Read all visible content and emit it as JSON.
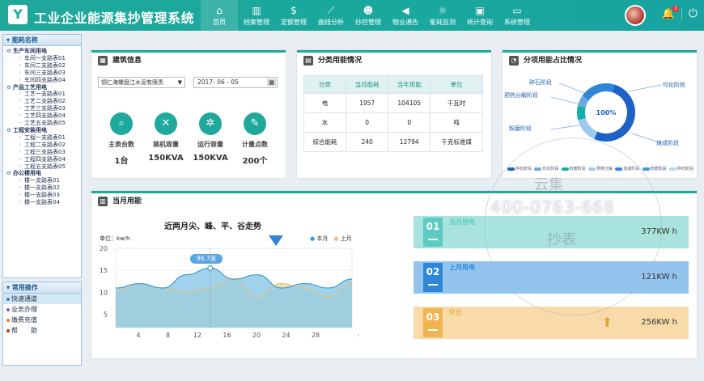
{
  "app": {
    "logo_letter": "Y",
    "title": "工业企业能源集抄管理系统"
  },
  "nav": [
    {
      "label": "首页",
      "icon": "home-icon",
      "glyph": "⌂"
    },
    {
      "label": "档案管理",
      "icon": "books-icon",
      "glyph": "▥"
    },
    {
      "label": "定额管理",
      "icon": "dollar-icon",
      "glyph": "$"
    },
    {
      "label": "曲线分析",
      "icon": "line-chart-icon",
      "glyph": "⟋"
    },
    {
      "label": "抄控管理",
      "icon": "users-icon",
      "glyph": "☻"
    },
    {
      "label": "物业通告",
      "icon": "megaphone-icon",
      "glyph": "◀"
    },
    {
      "label": "能耗监测",
      "icon": "alarm-icon",
      "glyph": "☼"
    },
    {
      "label": "统计查询",
      "icon": "briefcase-icon",
      "glyph": "▣"
    },
    {
      "label": "系统管理",
      "icon": "monitor-icon",
      "glyph": "▭"
    }
  ],
  "header": {
    "badge_count": "1"
  },
  "sidebar": {
    "tree_title": "能耗名称",
    "groups": [
      {
        "label": "生产车间用电",
        "items": [
          "车间一支路表01",
          "车间二支路表02",
          "车间三支路表03",
          "车间四支路表04"
        ]
      },
      {
        "label": "产品工艺用电",
        "items": [
          "工艺一支路表01",
          "工艺二支路表02",
          "工艺三支路表03",
          "工艺四支路表04",
          "工艺五支路表05"
        ]
      },
      {
        "label": "工程安装用电",
        "items": [
          "工程一支路表01",
          "工程二支路表02",
          "工程三支路表03",
          "工程四支路表04",
          "工程五支路表05"
        ]
      },
      {
        "label": "办公楼用电",
        "items": [
          "楼一支路表01",
          "楼一支路表02",
          "楼一支路表03",
          "楼一支路表04"
        ]
      }
    ],
    "ops_title": "常用操作",
    "ops": [
      {
        "label": "快速通道",
        "color": "#3a7bd5"
      },
      {
        "label": "业务办理",
        "color": "#8a56c7"
      },
      {
        "label": "缴费充值",
        "color": "#e67e22"
      },
      {
        "label": "帮　　助",
        "color": "#c0392b"
      }
    ]
  },
  "building": {
    "title": "建筑信息",
    "select_value": "铜仁海螺盘江水泥有限责",
    "date": "2017- 06 - 05",
    "stats": [
      {
        "label": "主表台数",
        "value": "1台",
        "icon": "search-icon",
        "glyph": "⌕"
      },
      {
        "label": "装机容量",
        "value": "150KVA",
        "icon": "tools-icon",
        "glyph": "✕"
      },
      {
        "label": "运行容量",
        "value": "150KVA",
        "icon": "gears-icon",
        "glyph": "✲"
      },
      {
        "label": "计量点数",
        "value": "200个",
        "icon": "edit-icon",
        "glyph": "✎"
      }
    ]
  },
  "category": {
    "title": "分类用能情况",
    "headers": [
      "分类",
      "当月能耗",
      "当年用能",
      "单位"
    ],
    "rows": [
      [
        "电",
        "1957",
        "104105",
        "千瓦时"
      ],
      [
        "水",
        "0",
        "0",
        "吨"
      ],
      [
        "综合能耗",
        "240",
        "12794",
        "千克标准煤"
      ]
    ]
  },
  "share": {
    "title": "分项用能占比情况",
    "center_label": "100%",
    "labels": [
      "碎石阶段",
      "预热分解阶段",
      "粉磨阶段",
      "均化阶段",
      "烧成阶段"
    ],
    "legend": [
      "碎石阶段",
      "均化阶段",
      "粉磨阶段",
      "预热分解",
      "烧成阶段",
      "粉磨阶段",
      "碎石阶段"
    ],
    "colors": [
      "#1e62c8",
      "#6aa8e0",
      "#12b0a8",
      "#9ec9ee",
      "#2f86d9",
      "#3aa0d8",
      "#b8d6f2"
    ],
    "chart_data": {
      "type": "pie",
      "categories": [
        "烧成阶段",
        "均化阶段",
        "碎石阶段",
        "预热分解阶段",
        "粉磨阶段"
      ],
      "values": [
        52,
        14,
        8,
        6,
        20
      ]
    }
  },
  "monthly": {
    "title": "当月用能",
    "chart_title": "近两月尖、峰、平、谷走势",
    "unit_label": "单位：kw/h",
    "tooltip": "96.7度",
    "legend_this": "本月",
    "legend_last": "上月",
    "colors": {
      "this": "#3a9bdc",
      "last": "#e8c27a",
      "this_fill": "#8fcbe8",
      "last_fill": "#f3d9a6"
    },
    "chart_data": {
      "type": "area",
      "x": [
        1,
        4,
        7,
        10,
        13,
        16,
        19,
        22,
        25,
        28,
        31
      ],
      "xticks": [
        "4",
        "8",
        "12",
        "16",
        "20",
        "24",
        "28"
      ],
      "xlabel": "(日期)",
      "yticks": [
        "5",
        "10",
        "15",
        "20"
      ],
      "ylim": [
        2,
        20
      ],
      "series": [
        {
          "name": "本月",
          "values": [
            11,
            12,
            11,
            14,
            15.5,
            13,
            14,
            11,
            12,
            11,
            13
          ]
        },
        {
          "name": "上月",
          "values": [
            10,
            12,
            11,
            10,
            11,
            13,
            9,
            12,
            11,
            9,
            12
          ]
        }
      ]
    },
    "cards": [
      {
        "num": "01",
        "label": "当月用电",
        "value": "377KW  h",
        "color": "#5ccbc2",
        "bg": "#a9e3dd"
      },
      {
        "num": "02",
        "label": "上月用电",
        "value": "121KW  h",
        "color": "#2f86d9",
        "bg": "#92c4ee"
      },
      {
        "num": "03",
        "label": "环比",
        "value": "256KW  h",
        "color": "#f0b350",
        "bg": "#f8dba8"
      }
    ]
  },
  "watermark": {
    "site": "www.njichaobiao.com",
    "phone": "400-0763-668",
    "top": "云集",
    "bottom": "抄表"
  }
}
